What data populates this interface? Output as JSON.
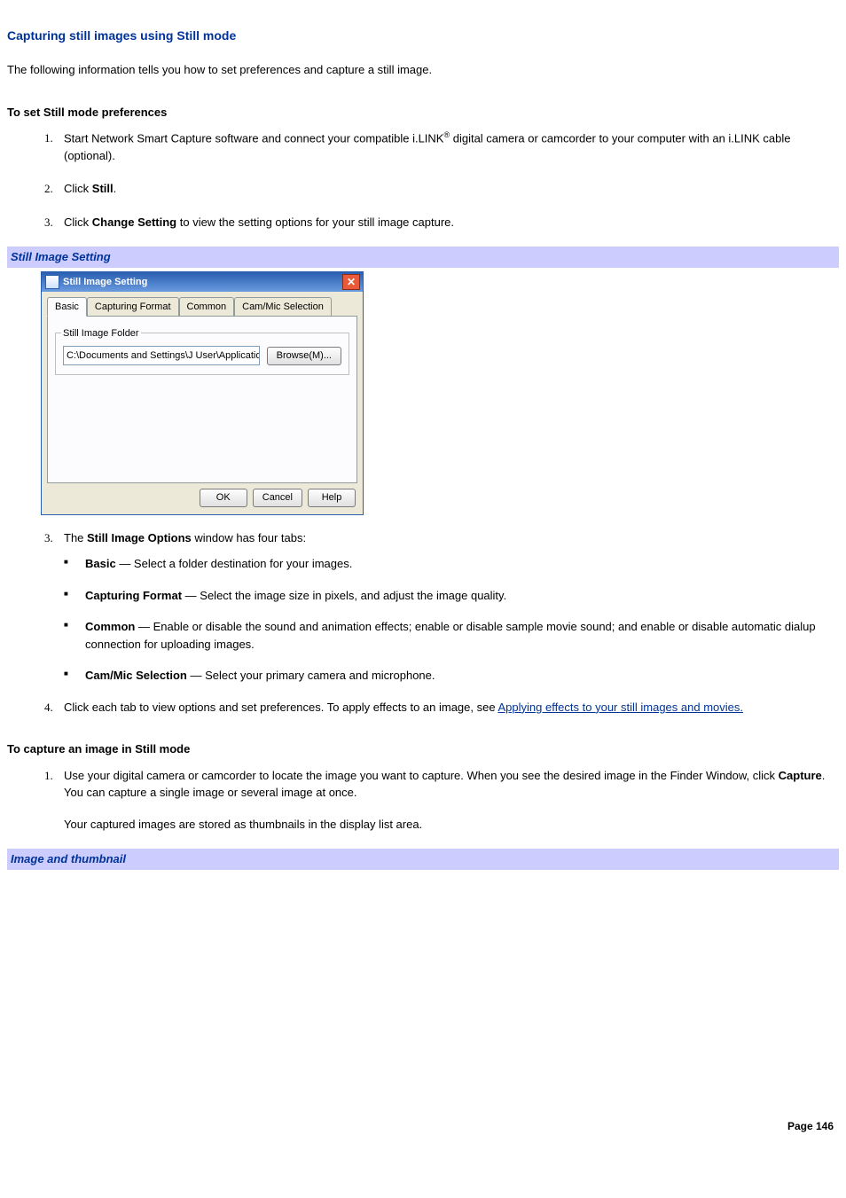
{
  "title": "Capturing still images using Still mode",
  "intro": "The following information tells you how to set preferences and capture a still image.",
  "prefs_heading": "To set Still mode preferences",
  "steps1": {
    "s1a": "Start Network Smart Capture software and connect your compatible i.LINK",
    "s1_reg": "®",
    "s1b": " digital camera or camcorder to your computer with an i.LINK cable (optional).",
    "s2_pre": "Click ",
    "s2_bold": "Still",
    "s2_post": ".",
    "s3_pre": "Click ",
    "s3_bold": "Change Setting",
    "s3_post": " to view the setting options for your still image capture."
  },
  "caption1": "Still Image Setting",
  "dialog": {
    "title": "Still Image Setting",
    "tabs": [
      "Basic",
      "Capturing Format",
      "Common",
      "Cam/Mic Selection"
    ],
    "group_label": "Still Image Folder",
    "path": "C:\\Documents and Settings\\J User\\Application Data\\So",
    "browse": "Browse(M)...",
    "ok": "OK",
    "cancel": "Cancel",
    "help": "Help"
  },
  "options_intro_pre": "The ",
  "options_intro_bold": "Still Image Options",
  "options_intro_post": " window has four tabs:",
  "opts": [
    {
      "name": "Basic",
      "desc": " — Select a folder destination for your images."
    },
    {
      "name": "Capturing Format",
      "desc": " — Select the image size in pixels, and adjust the image quality."
    },
    {
      "name": "Common",
      "desc": " — Enable or disable the sound and animation effects; enable or disable sample movie sound; and enable or disable automatic dialup connection for uploading images."
    },
    {
      "name": "Cam/Mic Selection",
      "desc": " — Select your primary camera and microphone."
    }
  ],
  "step4_pre": "Click each tab to view options and set preferences. To apply effects to an image, see ",
  "step4_link": "Applying effects to your still images and movies.",
  "capture_heading": "To capture an image in Still mode",
  "cap": {
    "s1_pre": "Use your digital camera or camcorder to locate the image you want to capture. When you see the desired image in the Finder Window, click ",
    "s1_bold": "Capture",
    "s1_post": ". You can capture a single image or several image at once.",
    "s1_note": "Your captured images are stored as thumbnails in the display list area."
  },
  "caption2": "Image and thumbnail",
  "page_label": "Page 146"
}
